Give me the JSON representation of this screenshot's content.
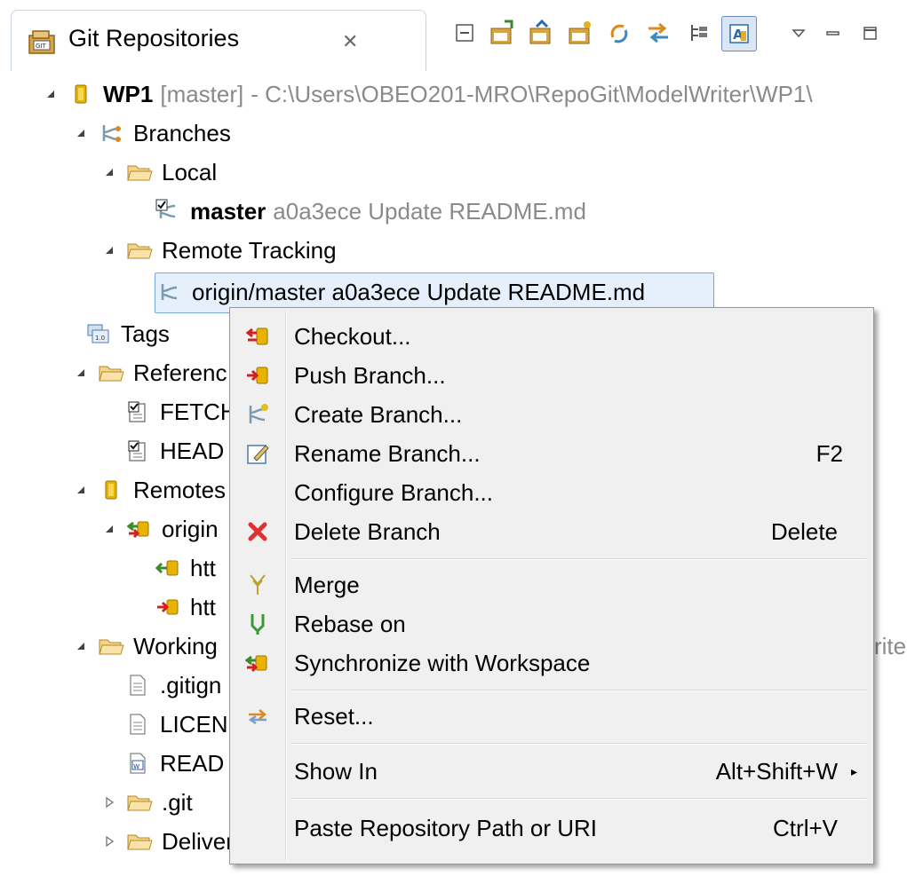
{
  "view": {
    "title": "Git Repositories",
    "close_glyph": "✕"
  },
  "toolbar": {
    "buttons": [
      "collapse-all-icon",
      "add-repository-icon",
      "clone-repository-icon",
      "create-repository-icon",
      "refresh-icon",
      "link-with-selection-icon",
      "show-hierarchical-icon",
      "show-files-icon",
      "view-menu-icon",
      "minimize-icon",
      "maximize-icon"
    ]
  },
  "tree": {
    "repo": {
      "name": "WP1",
      "branch": "[master]",
      "path": "- C:\\Users\\OBEO201-MRO\\RepoGit\\ModelWriter\\WP1\\"
    },
    "branches": "Branches",
    "local": "Local",
    "local_master": {
      "name": "master",
      "detail": "a0a3ece Update README.md"
    },
    "remote_tracking": "Remote Tracking",
    "origin_master": "origin/master a0a3ece Update README.md",
    "tags": "Tags",
    "references": "Referenc",
    "fetch_head": "FETCH",
    "head": "HEAD",
    "remotes": "Remotes",
    "origin": "origin",
    "fetch_url": "htt",
    "push_url": "htt",
    "working": "Working",
    "working_suffix": "rite",
    "gitignore": ".gitign",
    "license": "LICEN",
    "readme": "READ",
    "git_folder": ".git",
    "deliverables": "Deliverables"
  },
  "menu": {
    "items": [
      {
        "label": "Checkout...",
        "key": "",
        "icon": "checkout-icon"
      },
      {
        "label": "Push Branch...",
        "key": "",
        "icon": "push-icon"
      },
      {
        "label": "Create Branch...",
        "key": "",
        "icon": "create-branch-icon"
      },
      {
        "label": "Rename Branch...",
        "key": "F2",
        "icon": "rename-icon"
      },
      {
        "label": "Configure Branch...",
        "key": "",
        "icon": ""
      },
      {
        "label": "Delete Branch",
        "key": "Delete",
        "icon": "delete-icon"
      },
      {
        "label": "Merge",
        "key": "",
        "icon": "merge-icon"
      },
      {
        "label": "Rebase on",
        "key": "",
        "icon": "rebase-icon"
      },
      {
        "label": "Synchronize with Workspace",
        "key": "",
        "icon": "synchronize-icon"
      },
      {
        "label": "Reset...",
        "key": "",
        "icon": "reset-icon"
      },
      {
        "label": "Show In",
        "key": "Alt+Shift+W",
        "icon": ""
      },
      {
        "label": "Paste Repository Path or URI",
        "key": "Ctrl+V",
        "icon": ""
      }
    ],
    "submenu_arrow": "▸"
  }
}
